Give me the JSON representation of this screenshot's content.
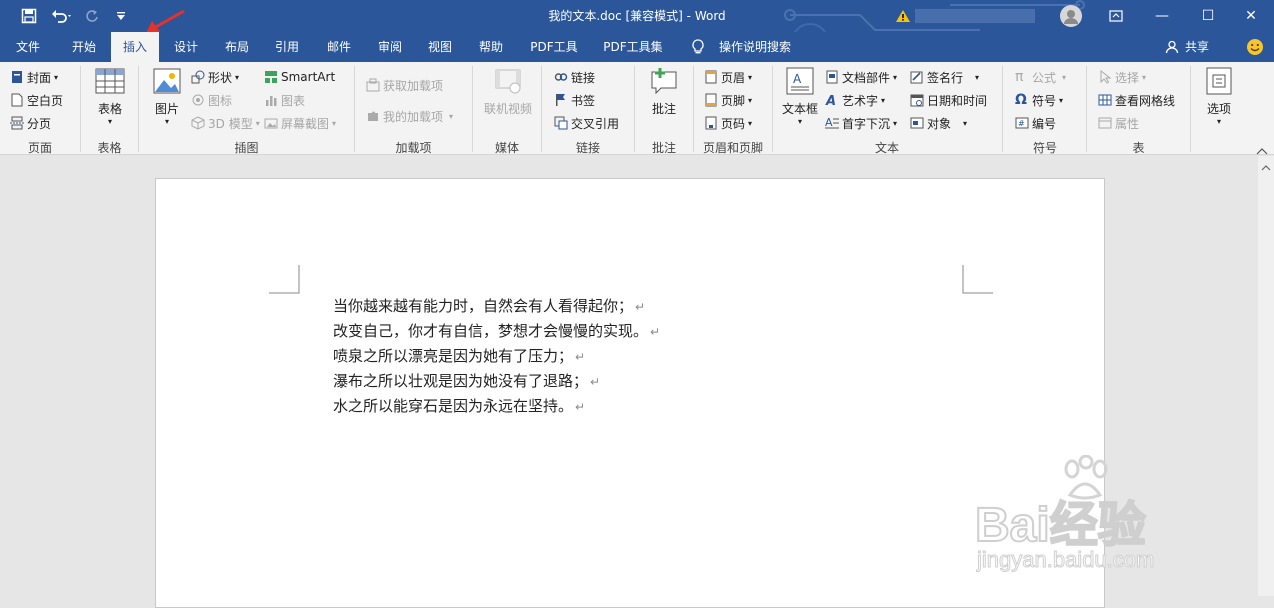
{
  "window": {
    "title": "我的文本.doc [兼容模式]  -  Word",
    "minimize": "—",
    "maximize": "☐",
    "close": "✕"
  },
  "tabs": [
    "文件",
    "开始",
    "插入",
    "设计",
    "布局",
    "引用",
    "邮件",
    "审阅",
    "视图",
    "帮助",
    "PDF工具",
    "PDF工具集"
  ],
  "active_tab": "插入",
  "tell_me": "操作说明搜索",
  "share": "共享",
  "ribbon": {
    "pages": {
      "cover": "封面",
      "blank": "空白页",
      "break": "分页",
      "label": "页面"
    },
    "tables": {
      "table": "表格",
      "label": "表格"
    },
    "illustrations": {
      "picture": "图片",
      "shapes": "形状",
      "icons": "图标",
      "model3d": "3D 模型",
      "smartart": "SmartArt",
      "chart": "图表",
      "screenshot": "屏幕截图",
      "label": "插图"
    },
    "addins": {
      "get": "获取加载项",
      "mine": "我的加载项",
      "label": "加载项"
    },
    "media": {
      "video": "联机视频",
      "label": "媒体"
    },
    "links": {
      "link": "链接",
      "bookmark": "书签",
      "crossref": "交叉引用",
      "label": "链接"
    },
    "comments": {
      "comment": "批注",
      "label": "批注"
    },
    "header_footer": {
      "header": "页眉",
      "footer": "页脚",
      "page_number": "页码",
      "label": "页眉和页脚"
    },
    "text": {
      "textbox": "文本框",
      "quickparts": "文档部件",
      "wordart": "艺术字",
      "dropcap": "首字下沉",
      "signature": "签名行",
      "datetime": "日期和时间",
      "object": "对象",
      "label": "文本"
    },
    "symbols": {
      "equation": "公式",
      "symbol": "符号",
      "numbering": "编号",
      "label": "符号"
    },
    "table_tools": {
      "select": "选择",
      "gridlines": "查看网格线",
      "properties": "属性",
      "label": "表"
    },
    "options": {
      "options": "选项"
    }
  },
  "document": {
    "lines": [
      "当你越来越有能力时，自然会有人看得起你；",
      "改变自己，你才有自信，梦想才会慢慢的实现。",
      "喷泉之所以漂亮是因为她有了压力；",
      "瀑布之所以壮观是因为她没有了退路；",
      "水之所以能穿石是因为永远在坚持。"
    ],
    "paragraph_mark": "↵"
  },
  "watermark": {
    "brand": "Bai经验",
    "url": "jingyan.baidu.com"
  },
  "colors": {
    "accent": "#2b579a",
    "ribbon_bg": "#f3f3f3",
    "arrow": "#e8312a"
  }
}
